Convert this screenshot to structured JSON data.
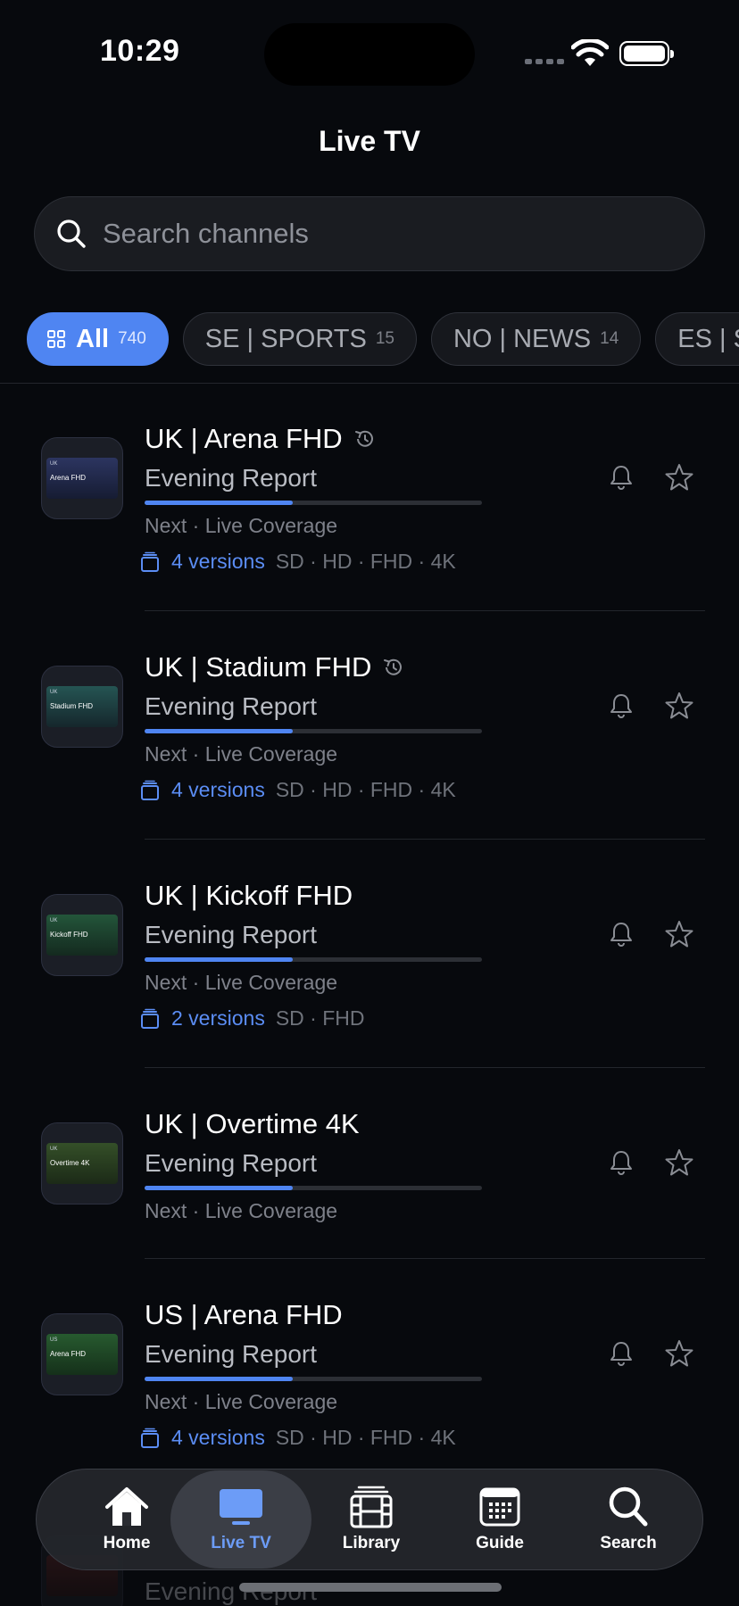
{
  "status_bar": {
    "time": "10:29"
  },
  "page_title": "Live TV",
  "search": {
    "placeholder": "Search channels",
    "value": ""
  },
  "filters": [
    {
      "label": "All",
      "count": "740",
      "active": true
    },
    {
      "label": "SE | SPORTS",
      "count": "15"
    },
    {
      "label": "NO | NEWS",
      "count": "14"
    },
    {
      "label": "ES | SPO",
      "count": ""
    }
  ],
  "channels": [
    {
      "name": "UK | Arena FHD",
      "logo_country": "UK",
      "logo_name": "Arena FHD",
      "program": "Evening Report",
      "progress": 0.44,
      "next": "Next · Live Coverage",
      "versions_label": "4 versions",
      "qualities": "SD · HD · FHD · 4K",
      "history_icon": true
    },
    {
      "name": "UK | Stadium FHD",
      "logo_country": "UK",
      "logo_name": "Stadium FHD",
      "program": "Evening Report",
      "progress": 0.44,
      "next": "Next · Live Coverage",
      "versions_label": "4 versions",
      "qualities": "SD · HD · FHD · 4K",
      "history_icon": true
    },
    {
      "name": "UK | Kickoff FHD",
      "logo_country": "UK",
      "logo_name": "Kickoff FHD",
      "program": "Evening Report",
      "progress": 0.44,
      "next": "Next · Live Coverage",
      "versions_label": "2 versions",
      "qualities": "SD · FHD"
    },
    {
      "name": "UK | Overtime 4K",
      "logo_country": "UK",
      "logo_name": "Overtime 4K",
      "program": "Evening Report",
      "progress": 0.44,
      "next": "Next · Live Coverage"
    },
    {
      "name": "US | Arena FHD",
      "logo_country": "US",
      "logo_name": "Arena FHD",
      "program": "Evening Report",
      "progress": 0.44,
      "next": "Next · Live Coverage",
      "versions_label": "4 versions",
      "qualities": "SD · HD · FHD · 4K"
    }
  ],
  "ghost_row": {
    "program": "Evening Report"
  },
  "tabs": [
    {
      "label": "Home",
      "icon": "house-icon"
    },
    {
      "label": "Live TV",
      "icon": "tv-icon",
      "active": true
    },
    {
      "label": "Library",
      "icon": "film-icon"
    },
    {
      "label": "Guide",
      "icon": "calendar-icon"
    },
    {
      "label": "Search",
      "icon": "magnifier-icon"
    }
  ],
  "colors": {
    "accent": "#4f85f2",
    "background": "#07090d"
  }
}
